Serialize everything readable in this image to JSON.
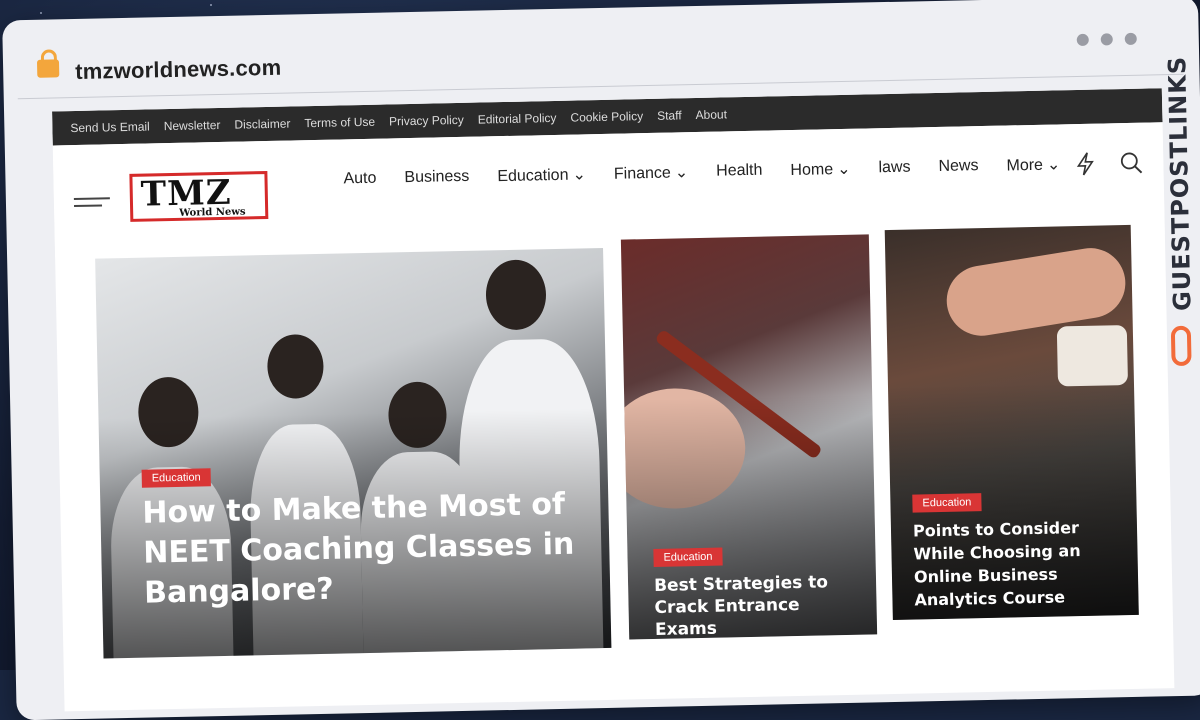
{
  "browser": {
    "url": "tmzworldnews.com",
    "watermark": "GUESTPOSTLINKS"
  },
  "site": {
    "topbar_links": [
      "Send Us Email",
      "Newsletter",
      "Disclaimer",
      "Terms of Use",
      "Privacy Policy",
      "Editorial Policy",
      "Cookie Policy",
      "Staff",
      "About"
    ],
    "logo": {
      "big": "TMZ",
      "small": "World News"
    },
    "menu": [
      {
        "label": "Auto",
        "dropdown": false
      },
      {
        "label": "Business",
        "dropdown": false
      },
      {
        "label": "Education",
        "dropdown": true
      },
      {
        "label": "Finance",
        "dropdown": true
      },
      {
        "label": "Health",
        "dropdown": false
      },
      {
        "label": "Home",
        "dropdown": true
      },
      {
        "label": "laws",
        "dropdown": false
      },
      {
        "label": "News",
        "dropdown": false
      },
      {
        "label": "More",
        "dropdown": true
      }
    ],
    "icons": [
      "lightning-icon",
      "search-icon"
    ]
  },
  "articles": [
    {
      "category": "Education",
      "title": "How to Make the Most of NEET Coaching Classes in Bangalore?"
    },
    {
      "category": "Education",
      "title": "Best Strategies to Crack Entrance Exams"
    },
    {
      "category": "Education",
      "title": "Points to Consider While Choosing an Online Business Analytics Course"
    }
  ],
  "colors": {
    "accent": "#d93535",
    "topbar": "#2b2b2b",
    "watermark_icon": "#f26b3a"
  }
}
